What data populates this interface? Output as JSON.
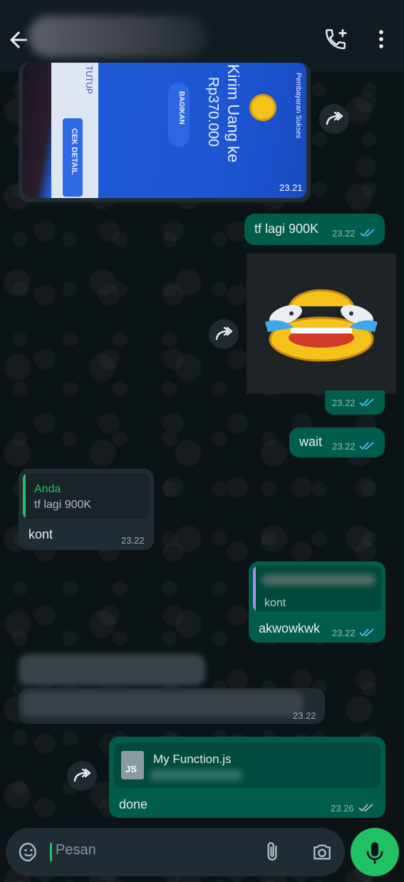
{
  "header": {
    "back_icon": "arrow-left-icon",
    "call_icon": "add-call-icon",
    "menu_icon": "more-vert-icon"
  },
  "messages": {
    "receipt_image": {
      "time": "23.21",
      "receipt": {
        "status": "Pembayaran Sukses",
        "title": "Kirim Uang ke",
        "amount": "Rp370.000",
        "share_label": "BAGIKAN",
        "detail_label": "CEK DETAIL",
        "close_label": "TUTUP"
      }
    },
    "msg_tf": {
      "text": "tf lagi 900K",
      "time": "23.22"
    },
    "emoji_image": {
      "time": "23.22"
    },
    "msg_wait": {
      "text": "wait",
      "time": "23.22"
    },
    "msg_kont": {
      "quote_author": "Anda",
      "quote_text": "tf lagi 900K",
      "text": "kont",
      "time": "23.22"
    },
    "msg_akwowkwk": {
      "quote_text": "kont",
      "text": "akwowkwk",
      "time": "23.22"
    },
    "msg_blurred": {
      "time": "23.22"
    },
    "msg_file": {
      "file_name": "My Function.js",
      "file_type": "JS",
      "text": "done",
      "time": "23.26"
    }
  },
  "composer": {
    "placeholder": "Pesan",
    "emoji_icon": "sticker-icon",
    "attach_icon": "paperclip-icon",
    "camera_icon": "camera-icon",
    "mic_icon": "mic-icon"
  },
  "colors": {
    "outgoing_bubble": "#005c4b",
    "incoming_bubble": "#202c33",
    "accent": "#21c063",
    "read_ticks": "#53bdeb"
  }
}
